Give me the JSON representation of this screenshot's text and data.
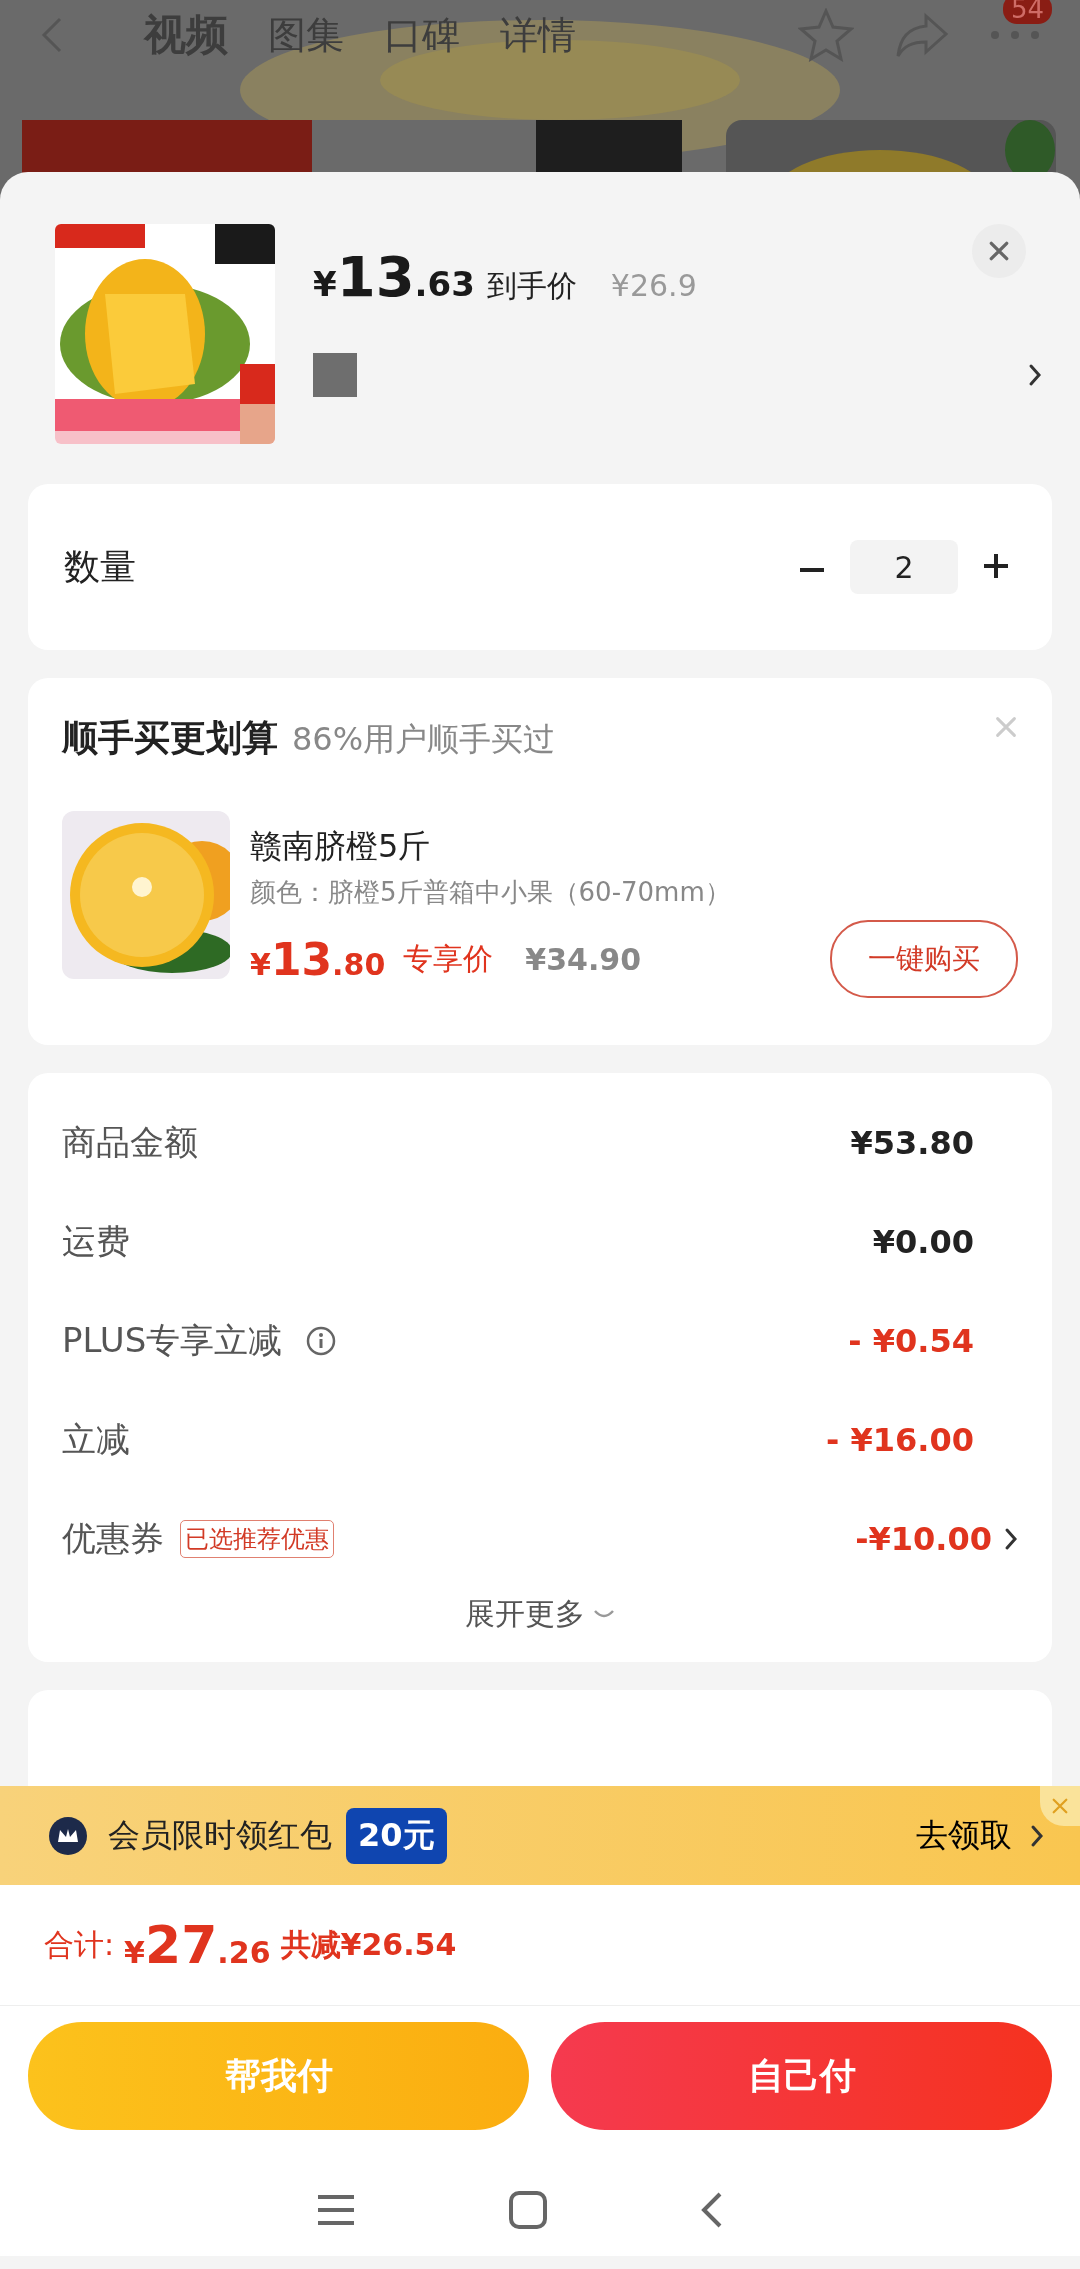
{
  "background_page": {
    "nav_tabs": [
      {
        "label": "视频",
        "selected": true
      },
      {
        "label": "图集",
        "selected": false
      },
      {
        "label": "口碑",
        "selected": false
      },
      {
        "label": "详情",
        "selected": false
      }
    ],
    "badge": "54"
  },
  "product": {
    "currency": "¥",
    "price_int": "13",
    "price_dec": ".63",
    "price_label": "到手价",
    "original_price": "¥26.9"
  },
  "quantity": {
    "label": "数量",
    "value": "2"
  },
  "upsell": {
    "title": "顺手买更划算",
    "subtitle": "86%用户顺手买过",
    "item": {
      "name": "赣南脐橙5斤",
      "spec": "颜色：脐橙5斤普箱中小果（60-70mm）",
      "currency": "¥",
      "price_int": "13",
      "price_dec": ".80",
      "price_label": "专享价",
      "original_price": "¥34.90",
      "button": "一键购买"
    }
  },
  "summary": {
    "rows": [
      {
        "kind": "amount",
        "label": "商品金额",
        "value": "¥53.80"
      },
      {
        "kind": "amount",
        "label": "运费",
        "value": "¥0.00"
      },
      {
        "kind": "discount_info",
        "label": "PLUS专享立减",
        "value": "- ¥0.54"
      },
      {
        "kind": "discount",
        "label": "立减",
        "value": "- ¥16.00"
      },
      {
        "kind": "coupon",
        "label": "优惠券",
        "tag": "已选推荐优惠",
        "value": "-¥10.00"
      }
    ],
    "expand": "展开更多"
  },
  "promo_banner": {
    "text": "会员限时领红包",
    "badge": "20元",
    "action": "去领取"
  },
  "total": {
    "label": "合计:",
    "currency": "¥",
    "int": "27",
    "dec": ".26",
    "saved": "共减¥26.54"
  },
  "buttons": [
    {
      "kind": "secondary",
      "label": "帮我付"
    },
    {
      "kind": "primary",
      "label": "自己付"
    }
  ]
}
